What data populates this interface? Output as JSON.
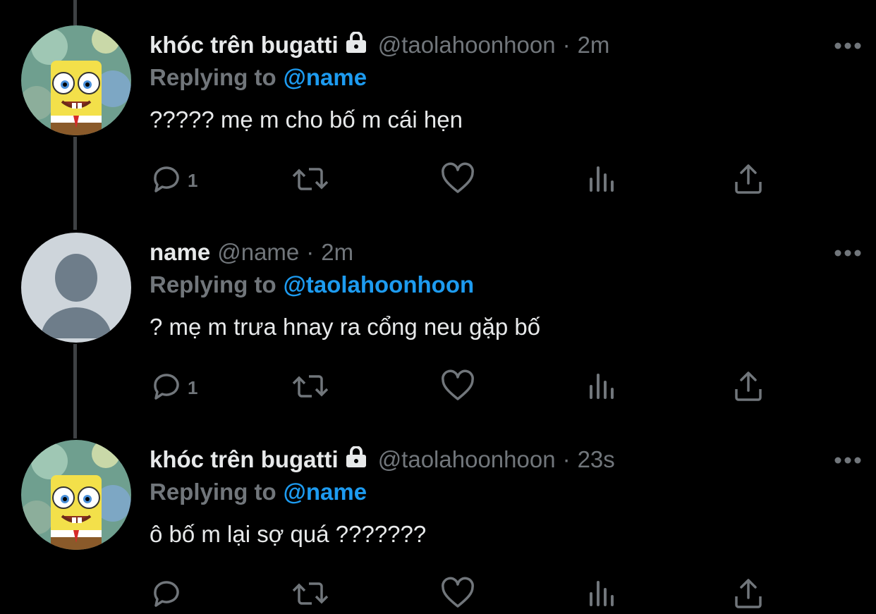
{
  "tweets": [
    {
      "display_name": "khóc trên bugatti",
      "protected": true,
      "handle": "@taolahoonhoon",
      "separator": "·",
      "time": "2m",
      "replying_label": "Replying to",
      "replying_to": "@name",
      "text": "????? mẹ m cho bố m cái hẹn",
      "reply_count": "1",
      "avatar": "spongebob-avatar"
    },
    {
      "display_name": "name",
      "protected": false,
      "handle": "@name",
      "separator": "·",
      "time": "2m",
      "replying_label": "Replying to",
      "replying_to": "@taolahoonhoon",
      "text": "? mẹ m trưa hnay ra cổng neu gặp bố",
      "reply_count": "1",
      "avatar": "default-avatar"
    },
    {
      "display_name": "khóc trên bugatti",
      "protected": true,
      "handle": "@taolahoonhoon",
      "separator": "·",
      "time": "23s",
      "replying_label": "Replying to",
      "replying_to": "@name",
      "text": "ô bố m lại sợ quá ???????",
      "reply_count": "",
      "avatar": "spongebob-avatar"
    }
  ],
  "icons": {
    "reply": "reply-icon",
    "retweet": "retweet-icon",
    "like": "like-icon",
    "views": "views-icon",
    "share": "share-icon",
    "more": "more-icon",
    "lock": "lock-icon"
  },
  "colors": {
    "background": "#000000",
    "text": "#e7e9ea",
    "secondary": "#71767b",
    "accent": "#1d9bf0"
  }
}
